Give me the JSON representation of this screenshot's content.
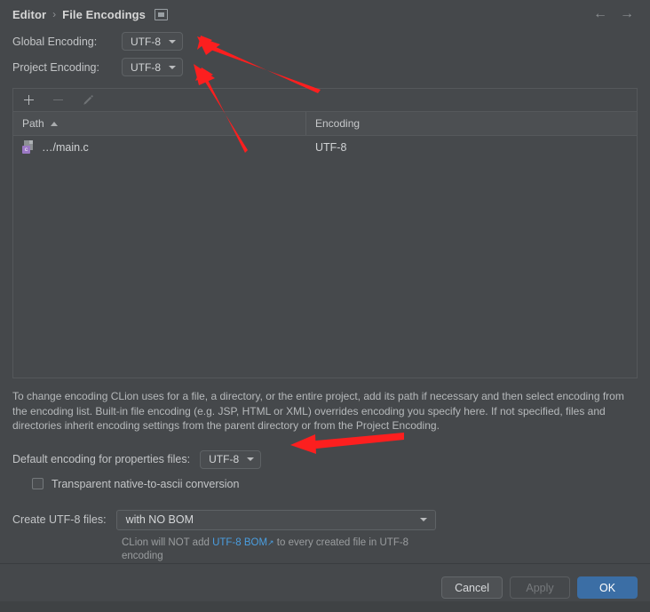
{
  "dialog": {
    "breadcrumb": {
      "parent": "Editor",
      "separator": "›",
      "current": "File Encodings",
      "panel_icon": "panel-toggle-icon"
    },
    "nav": {
      "back": "←",
      "forward": "→"
    }
  },
  "global_encoding": {
    "label": "Global Encoding:",
    "value": "UTF-8"
  },
  "project_encoding": {
    "label": "Project Encoding:",
    "value": "UTF-8"
  },
  "table": {
    "toolbar": {
      "add": "+",
      "remove": "−",
      "edit": "pencil-icon"
    },
    "columns": [
      {
        "label": "Path",
        "sort": "ascending"
      },
      {
        "label": "Encoding",
        "sort": "none"
      }
    ],
    "rows": [
      {
        "icon": "c-source-file-icon",
        "icon_badge": "c",
        "path": "…/main.c",
        "encoding": "UTF-8"
      }
    ]
  },
  "description": "To change encoding CLion uses for a file, a directory, or the entire project, add its path if necessary and then select encoding from the encoding list. Built-in file encoding (e.g. JSP, HTML or XML) overrides encoding you specify here. If not specified, files and directories inherit encoding settings from the parent directory or from the Project Encoding.",
  "properties": {
    "label": "Default encoding for properties files:",
    "value": "UTF-8",
    "checkbox": {
      "label": "Transparent native-to-ascii conversion",
      "checked": false
    }
  },
  "bom": {
    "label": "Create UTF-8 files:",
    "value": "with NO BOM",
    "note_before": "CLion will NOT add ",
    "note_link": "UTF-8 BOM",
    "note_link_arrow": "↗",
    "note_after": " to every created file in UTF-8 encoding"
  },
  "footer": {
    "cancel": "Cancel",
    "apply": "Apply",
    "ok": "OK"
  },
  "colors": {
    "dialog_background": "#45484b",
    "table_background": "#46494c",
    "accent_default_button": "#3b6ea5",
    "link": "#4a9ee0",
    "annotation_arrow": "#fc1f1f",
    "file_badge": "#9b78c4"
  },
  "annotations": [
    {
      "name": "arrow-to-global-encoding",
      "color": "#fc1f1f"
    },
    {
      "name": "arrow-to-project-encoding",
      "color": "#fc1f1f"
    },
    {
      "name": "arrow-to-properties-encoding",
      "color": "#fc1f1f"
    }
  ]
}
